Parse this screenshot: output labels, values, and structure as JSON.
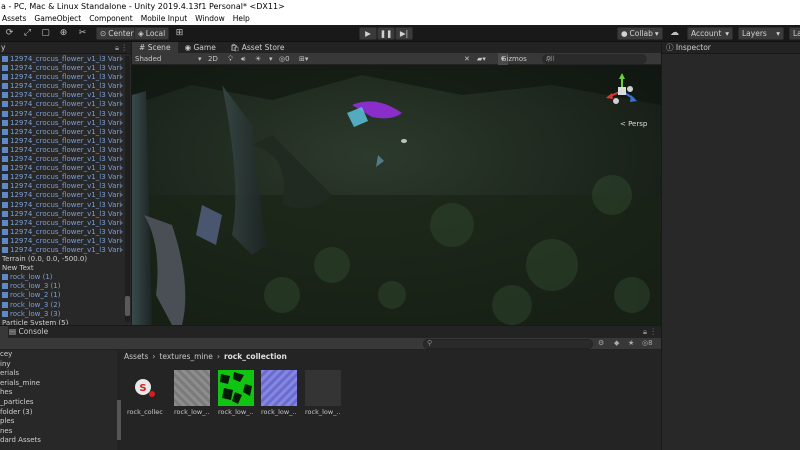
{
  "window": {
    "title": "a - PC, Mac & Linux Standalone - Unity 2019.4.13f1 Personal* <DX11>"
  },
  "menu": [
    "Assets",
    "GameObject",
    "Component",
    "Mobile Input",
    "Window",
    "Help"
  ],
  "toolbar": {
    "pivot": "Center",
    "space": "Local",
    "collab": "Collab",
    "account": "Account",
    "layers": "Layers",
    "layout": "La"
  },
  "hierarchy": {
    "tab_label": "y",
    "items": [
      {
        "label": "12974_crocus_flower_v1_l3 Vari",
        "prefab": true
      },
      {
        "label": "12974_crocus_flower_v1_l3 Vari",
        "prefab": true
      },
      {
        "label": "12974_crocus_flower_v1_l3 Vari",
        "prefab": true
      },
      {
        "label": "12974_crocus_flower_v1_l3 Vari",
        "prefab": true
      },
      {
        "label": "12974_crocus_flower_v1_l3 Vari",
        "prefab": true
      },
      {
        "label": "12974_crocus_flower_v1_l3 Vari",
        "prefab": true
      },
      {
        "label": "12974_crocus_flower_v1_l3 Vari",
        "prefab": true
      },
      {
        "label": "12974_crocus_flower_v1_l3 Vari",
        "prefab": true
      },
      {
        "label": "12974_crocus_flower_v1_l3 Vari",
        "prefab": true
      },
      {
        "label": "12974_crocus_flower_v1_l3 Vari",
        "prefab": true
      },
      {
        "label": "12974_crocus_flower_v1_l3 Vari",
        "prefab": true
      },
      {
        "label": "12974_crocus_flower_v1_l3 Vari",
        "prefab": true
      },
      {
        "label": "12974_crocus_flower_v1_l3 Vari",
        "prefab": true
      },
      {
        "label": "12974_crocus_flower_v1_l3 Vari",
        "prefab": true
      },
      {
        "label": "12974_crocus_flower_v1_l3 Vari",
        "prefab": true
      },
      {
        "label": "12974_crocus_flower_v1_l3 Vari",
        "prefab": true
      },
      {
        "label": "12974_crocus_flower_v1_l3 Vari",
        "prefab": true
      },
      {
        "label": "12974_crocus_flower_v1_l3 Vari",
        "prefab": true
      },
      {
        "label": "12974_crocus_flower_v1_l3 Vari",
        "prefab": true
      },
      {
        "label": "12974_crocus_flower_v1_l3 Vari",
        "prefab": true
      },
      {
        "label": "12974_crocus_flower_v1_l3 Vari",
        "prefab": true
      },
      {
        "label": "12974_crocus_flower_v1_l3 Vari",
        "prefab": true
      },
      {
        "label": "Terrain (0.0, 0.0, -500.0)",
        "prefab": false
      },
      {
        "label": "New Text",
        "prefab": false
      },
      {
        "label": "rock_low (1)",
        "prefab": true
      },
      {
        "label": "rock_low_3 (1)",
        "prefab": true
      },
      {
        "label": "rock_low_2 (1)",
        "prefab": true
      },
      {
        "label": "rock_low_3 (2)",
        "prefab": true
      },
      {
        "label": "rock_low_3 (3)",
        "prefab": true
      },
      {
        "label": "Particle System (5)",
        "prefab": false
      }
    ]
  },
  "scene": {
    "tabs": [
      "Scene",
      "Game",
      "Asset Store"
    ],
    "shading_mode": "Shaded",
    "mode_2d": "2D",
    "gizmos": "Gizmos",
    "search_placeholder": "All",
    "projection": "< Persp"
  },
  "inspector": {
    "tab_label": "Inspector"
  },
  "project": {
    "console_tab": "Console",
    "breadcrumb": [
      "Assets",
      "textures_mine",
      "rock_collection"
    ],
    "folders": [
      "cey",
      "iny",
      "erials",
      "erials_mine",
      "hes",
      "_particles",
      "folder (3)",
      "ples",
      "nes",
      "dard Assets"
    ],
    "assets": [
      {
        "label": "rock_collec...",
        "color": "#2b2b2b"
      },
      {
        "label": "rock_low_...",
        "color": "#8a8a8a"
      },
      {
        "label": "rock_low_...",
        "color": "#11c411"
      },
      {
        "label": "rock_low_...",
        "color": "#7a7bd8"
      },
      {
        "label": "rock_low_...",
        "color": "#343434"
      }
    ],
    "count": "8"
  }
}
